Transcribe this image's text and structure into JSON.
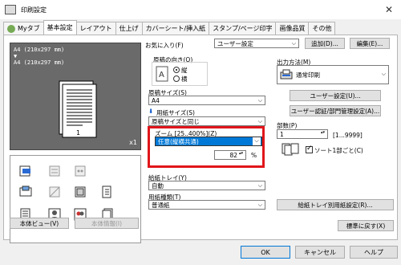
{
  "window": {
    "title": "印刷設定",
    "close_glyph": "✕"
  },
  "tabs": [
    {
      "label": "Myタブ",
      "active": false
    },
    {
      "label": "基本設定",
      "active": true
    },
    {
      "label": "レイアウト",
      "active": false
    },
    {
      "label": "仕上げ",
      "active": false
    },
    {
      "label": "カバーシート/挿入紙",
      "active": false
    },
    {
      "label": "スタンプ/ページ印字",
      "active": false
    },
    {
      "label": "画像品質",
      "active": false
    },
    {
      "label": "その他",
      "active": false
    }
  ],
  "preview": {
    "paper_label_line1": "A4 (210x297 mm)",
    "paper_label_arrow": "▼",
    "paper_label_line2": "A4 (210x297 mm)",
    "copies_badge": "x1"
  },
  "left_buttons": {
    "view": "本体ビュー(V)",
    "info": "本体情報(I)"
  },
  "favorites": {
    "label": "お気に入り(F)",
    "value": "ユーザー設定",
    "add": "追加(D)...",
    "edit": "編集(E)..."
  },
  "orientation": {
    "label": "原稿の向き(O)",
    "portrait": "縦",
    "landscape": "横",
    "selected": "portrait"
  },
  "original_size": {
    "label": "原稿サイズ(S)",
    "value": "A4"
  },
  "paper_size": {
    "label": "用紙サイズ(S)",
    "value": "原稿サイズと同じ"
  },
  "zoom": {
    "label": "ズーム [25..400%](Z)",
    "value": "任意(縦横共通)",
    "percent": "82",
    "unit": "%"
  },
  "paper_tray": {
    "label": "給紙トレイ(Y)",
    "value": "自動"
  },
  "paper_type": {
    "label": "用紙種類(T)",
    "value": "普通紙"
  },
  "output": {
    "label": "出力方法(M)",
    "value": "通常印刷",
    "user_settings": "ユーザー設定(U)...",
    "auth_settings": "ユーザー認証/部門管理設定(A)..."
  },
  "copies": {
    "label": "部数(P)",
    "value": "1",
    "range": "[1...9999]",
    "collate_label": "ソート1部ごと(C)",
    "collate_checked": true
  },
  "tray_settings": {
    "label": "給紙トレイ別用紙設定(R)..."
  },
  "restore": {
    "label": "標準に戻す(X)"
  },
  "dialog_buttons": {
    "ok": "OK",
    "cancel": "キャンセル",
    "help": "ヘルプ"
  },
  "colors": {
    "highlight": "#e0161b",
    "selection": "#0078d7",
    "preview_bg": "#6a6a6a"
  }
}
